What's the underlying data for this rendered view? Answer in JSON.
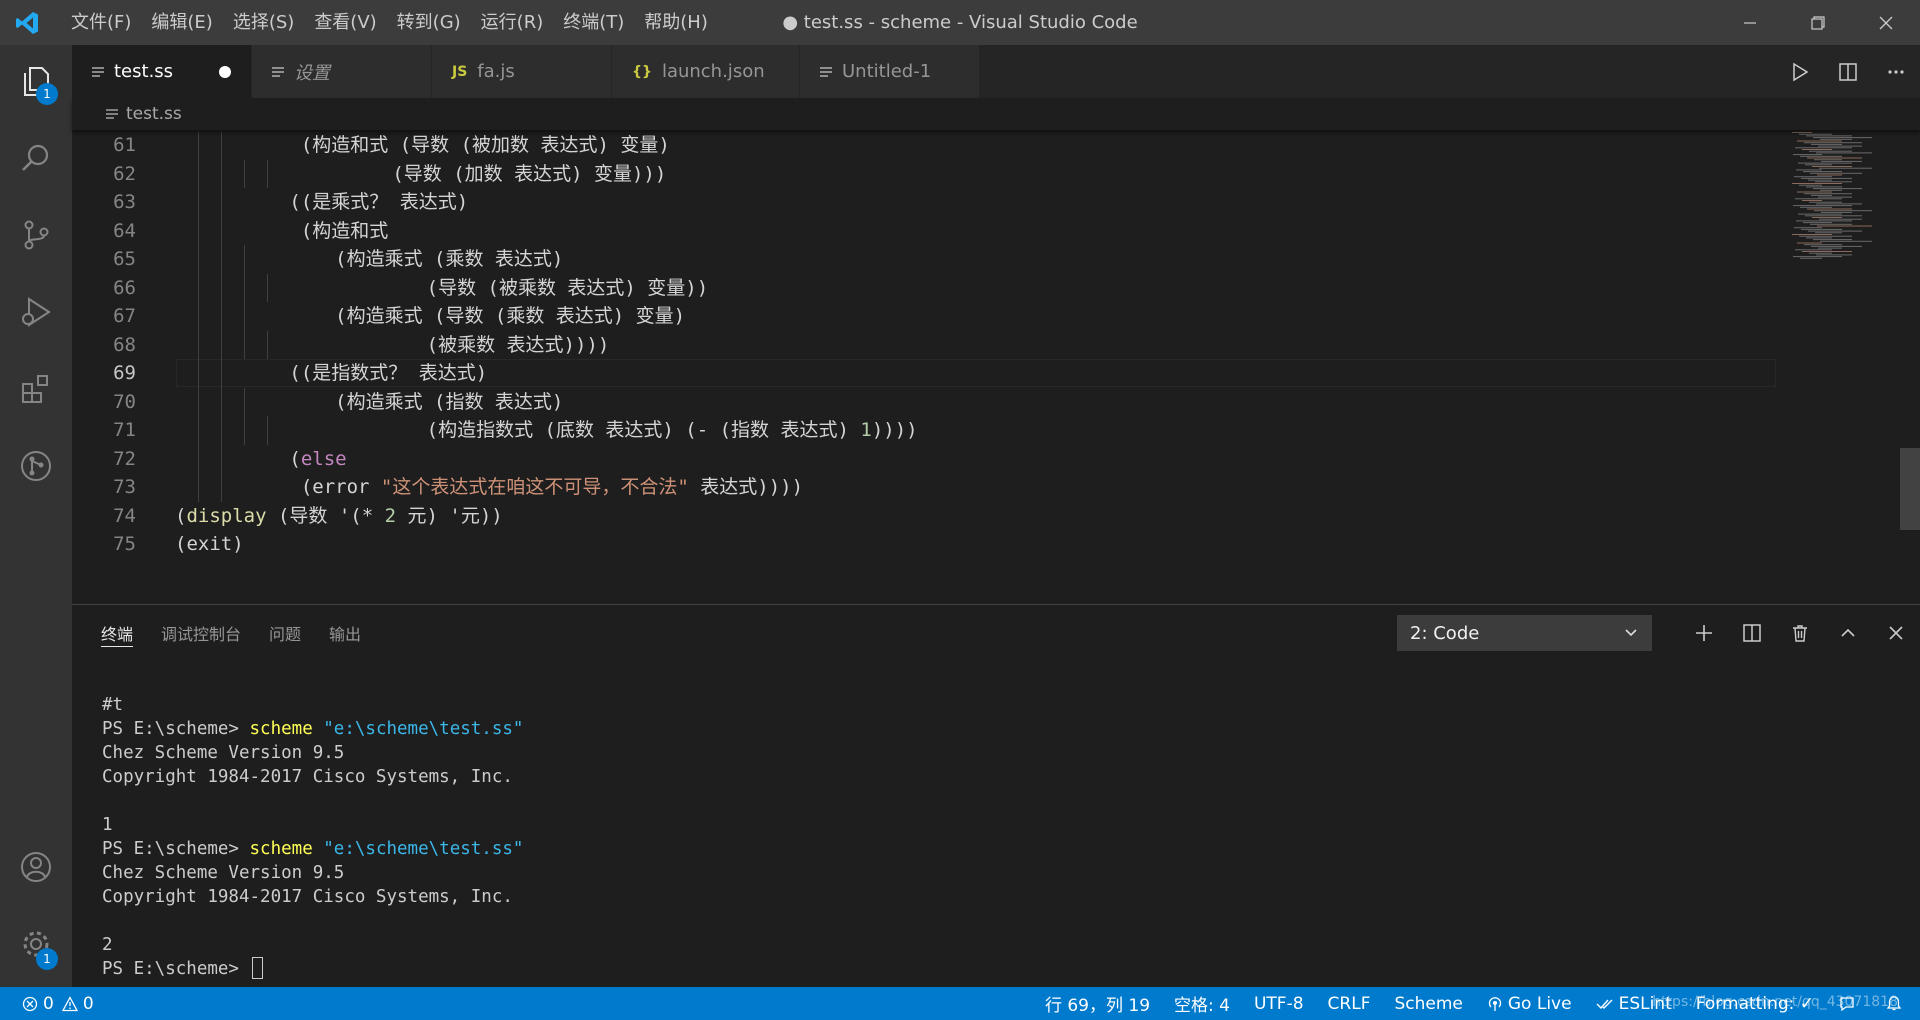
{
  "window": {
    "title": "● test.ss - scheme - Visual Studio Code"
  },
  "menu": [
    "文件(F)",
    "编辑(E)",
    "选择(S)",
    "查看(V)",
    "转到(G)",
    "运行(R)",
    "终端(T)",
    "帮助(H)"
  ],
  "activity": {
    "explorer_badge": "1",
    "settings_badge": "1"
  },
  "tabs": [
    {
      "label": "test.ss",
      "icon": "lines-file-icon",
      "dirty": true,
      "active": true
    },
    {
      "label": "设置",
      "icon": "lines-file-icon",
      "italic": true
    },
    {
      "label": "fa.js",
      "icon_text": "JS"
    },
    {
      "label": "launch.json",
      "icon_text": "{}"
    },
    {
      "label": "Untitled-1",
      "icon": "lines-file-icon"
    }
  ],
  "breadcrumb": {
    "file": "test.ss"
  },
  "editor": {
    "current_line": "69",
    "lines": [
      {
        "n": "61",
        "pad": "          ",
        "text": " (构造和式 (导数 (被加数 表达式) 变量)"
      },
      {
        "n": "62",
        "pad": "                  ",
        "text": " (导数 (加数 表达式) 变量)))"
      },
      {
        "n": "63",
        "pad": "          ",
        "text": "((是乘式？ 表达式)"
      },
      {
        "n": "64",
        "pad": "          ",
        "text": " (构造和式"
      },
      {
        "n": "65",
        "pad": "              ",
        "text": "(构造乘式 (乘数 表达式)"
      },
      {
        "n": "66",
        "pad": "                      ",
        "text": "(导数 (被乘数 表达式) 变量))"
      },
      {
        "n": "67",
        "pad": "              ",
        "text": "(构造乘式 (导数 (乘数 表达式) 变量)"
      },
      {
        "n": "68",
        "pad": "                      ",
        "text": "(被乘数 表达式))))"
      },
      {
        "n": "69",
        "pad": "          ",
        "text": "((是指数式？ 表达式)"
      },
      {
        "n": "70",
        "pad": "              ",
        "text": "(构造乘式 (指数 表达式)"
      },
      {
        "n": "71",
        "pad": "                      ",
        "pre": "(构造指数式 (底数 表达式) (- (指数 表达式) ",
        "num": "1",
        "post": "))))"
      },
      {
        "n": "72",
        "pad": "          ",
        "pre": "(",
        "kw": "else",
        "post": ""
      },
      {
        "n": "73",
        "pad": "           ",
        "pre": "(error ",
        "str": "\"这个表达式在咱这不可导，不合法\"",
        "post": " 表达式))))"
      },
      {
        "n": "74",
        "pad": "",
        "pre": "(",
        "fn": "display",
        "post": " (导数 '(* ",
        "num": "2",
        "post2": " 元) '元))"
      },
      {
        "n": "75",
        "pad": "",
        "text": "(exit)"
      }
    ]
  },
  "panel": {
    "tabs": [
      "终端",
      "调试控制台",
      "问题",
      "输出"
    ],
    "active_tab": "终端",
    "terminal_select": "2: Code",
    "terminal_lines": [
      {
        "text": "#t"
      },
      {
        "prompt": "PS E:\\scheme> ",
        "cmd": "scheme",
        "arg": " \"e:\\scheme\\test.ss\""
      },
      {
        "text": "Chez Scheme Version 9.5"
      },
      {
        "text": "Copyright 1984-2017 Cisco Systems, Inc."
      },
      {
        "text": ""
      },
      {
        "text": "1"
      },
      {
        "prompt": "PS E:\\scheme> ",
        "cmd": "scheme",
        "arg": " \"e:\\scheme\\test.ss\""
      },
      {
        "text": "Chez Scheme Version 9.5"
      },
      {
        "text": "Copyright 1984-2017 Cisco Systems, Inc."
      },
      {
        "text": ""
      },
      {
        "text": "2"
      },
      {
        "prompt": "PS E:\\scheme> ",
        "cursor": true
      }
    ]
  },
  "status": {
    "errors": "0",
    "warnings": "0",
    "position": "行 69，列 19",
    "spaces": "空格: 4",
    "encoding": "UTF-8",
    "eol": "CRLF",
    "language": "Scheme",
    "golive": "Go Live",
    "eslint": "ESLint",
    "formatting": "Formatting: ✓",
    "watermark": "https://blog.csdn.net/qq_43071818"
  },
  "colors": {
    "accent": "#007acc",
    "keyword": "#c586c0",
    "string": "#ce9178",
    "number": "#b5cea8",
    "function": "#dcdcaa",
    "terminal_cmd": "#ffff55",
    "terminal_str": "#3bb6e8"
  }
}
